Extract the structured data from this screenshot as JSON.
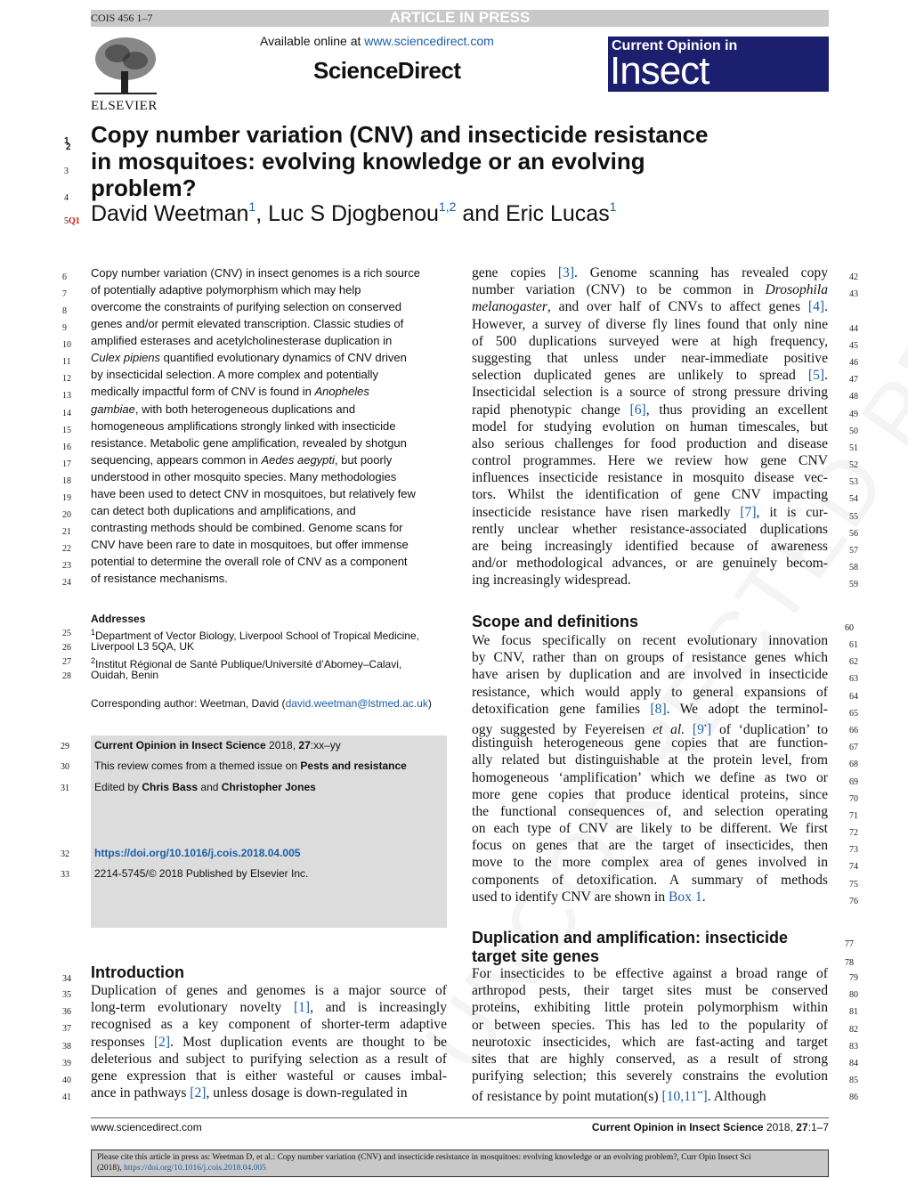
{
  "header": {
    "code": "COIS 456 1–7",
    "banner": "ARTICLE IN PRESS",
    "available_prefix": "Available online at ",
    "available_link": "www.sciencedirect.com",
    "sciencedirect": "ScienceDirect",
    "publisher": "ELSEVIER",
    "journal_line1": "Current Opinion in",
    "journal_line2": "Insect Science",
    "journal_color": "#1c1f6e"
  },
  "watermark": "UNCORRECTED PROOF",
  "title": {
    "lines": [
      {
        "n": "1",
        "n2": "2",
        "t": "Copy number variation (CNV) and insecticide resistance"
      },
      {
        "n": "3",
        "t": "in mosquitoes: evolving knowledge or an evolving"
      },
      {
        "n": "4",
        "t": "problem?"
      }
    ]
  },
  "authors": {
    "n": "5",
    "q": "Q1",
    "a1": "David Weetman",
    "s1": "1",
    "sep1": ", ",
    "a2": "Luc S Djogbenou",
    "s2": "1,2",
    "sep2": " and ",
    "a3": "Eric Lucas",
    "s3": "1"
  },
  "abstract": [
    {
      "n": "6",
      "p": [
        "Copy number variation (CNV) in insect genomes is a rich source"
      ]
    },
    {
      "n": "7",
      "p": [
        "of potentially adaptive polymorphism which may help"
      ]
    },
    {
      "n": "8",
      "p": [
        "overcome the constraints of purifying selection on conserved"
      ]
    },
    {
      "n": "9",
      "p": [
        "genes and/or permit elevated transcription. Classic studies of"
      ]
    },
    {
      "n": "10",
      "p": [
        "amplified esterases and acetylcholinesterase duplication in"
      ]
    },
    {
      "n": "11",
      "p": [
        [
          "Culex pipiens",
          "i"
        ],
        " quantified evolutionary dynamics of CNV driven"
      ]
    },
    {
      "n": "12",
      "p": [
        "by insecticidal selection. A more complex and potentially"
      ]
    },
    {
      "n": "13",
      "p": [
        "medically impactful form of CNV is found in ",
        [
          "Anopheles",
          "i"
        ]
      ]
    },
    {
      "n": "14",
      "p": [
        [
          "gambiae",
          "i"
        ],
        ", with both heterogeneous duplications and"
      ]
    },
    {
      "n": "15",
      "p": [
        "homogeneous amplifications strongly linked with insecticide"
      ]
    },
    {
      "n": "16",
      "p": [
        "resistance. Metabolic gene amplification, revealed by shotgun"
      ]
    },
    {
      "n": "17",
      "p": [
        "sequencing, appears common in ",
        [
          "Aedes aegypti",
          "i"
        ],
        ", but poorly"
      ]
    },
    {
      "n": "18",
      "p": [
        "understood in other mosquito species. Many methodologies"
      ]
    },
    {
      "n": "19",
      "p": [
        "have been used to detect CNV in mosquitoes, but relatively few"
      ]
    },
    {
      "n": "20",
      "p": [
        "can detect both duplications and amplifications, and"
      ]
    },
    {
      "n": "21",
      "p": [
        "contrasting methods should be combined. Genome scans for"
      ]
    },
    {
      "n": "22",
      "p": [
        "CNV have been rare to date in mosquitoes, but offer immense"
      ]
    },
    {
      "n": "23",
      "p": [
        "potential to determine the overall role of CNV as a component"
      ]
    },
    {
      "n": "24",
      "p": [
        "of resistance mechanisms."
      ]
    }
  ],
  "addresses": {
    "heading": "Addresses",
    "lines": [
      {
        "n": "25",
        "p": [
          [
            "1",
            "sup"
          ],
          "Department of Vector Biology, Liverpool School of Tropical Medicine,"
        ]
      },
      {
        "n": "26",
        "p": [
          "Liverpool L3 5QA, UK"
        ]
      },
      {
        "n": "27",
        "p": [
          [
            "2",
            "sup"
          ],
          "Institut Régional de Santé Publique/Université d’Abomey–Calavi,"
        ]
      },
      {
        "n": "28",
        "p": [
          "Ouidah, Benin"
        ]
      }
    ],
    "corresponding": [
      "Corresponding author: Weetman, David (",
      [
        "david.weetman@lstmed.ac.uk",
        "l"
      ],
      ")"
    ]
  },
  "infobox": [
    {
      "n": "29",
      "p": [
        [
          "Current Opinion in Insect Science",
          "b"
        ],
        " 2018, ",
        [
          "27",
          "b"
        ],
        ":xx–yy"
      ]
    },
    {
      "n": "30",
      "p": [
        "This review comes from a themed issue on ",
        [
          "Pests and resistance",
          "b"
        ]
      ]
    },
    {
      "n": "31",
      "p": [
        "Edited by ",
        [
          "Chris Bass",
          "b"
        ],
        " and ",
        [
          "Christopher Jones",
          "b"
        ]
      ]
    },
    {
      "n": "32",
      "p": [
        [
          "https://doi.org/10.1016/j.cois.2018.04.005",
          "lb"
        ]
      ]
    },
    {
      "n": "33",
      "p": [
        "2214-5745/© 2018 Published by Elsevier Inc."
      ]
    }
  ],
  "introduction": {
    "n": "34",
    "heading": "Introduction",
    "lines": [
      {
        "n": "35",
        "p": [
          "Duplication of genes and genomes is a major source of"
        ]
      },
      {
        "n": "36",
        "p": [
          "long-term evolutionary novelty ",
          [
            "[1]",
            "l"
          ],
          ", and is increasingly"
        ]
      },
      {
        "n": "37",
        "p": [
          "recognised as a key component of shorter-term adaptive"
        ]
      },
      {
        "n": "38",
        "p": [
          "responses ",
          [
            "[2]",
            "l"
          ],
          ". Most duplication events are thought to be"
        ]
      },
      {
        "n": "39",
        "p": [
          "deleterious and subject to purifying selection as a result of"
        ]
      },
      {
        "n": "40",
        "p": [
          "gene expression that is either wasteful or causes imbal-"
        ]
      },
      {
        "n": "41",
        "p": [
          "ance in pathways ",
          [
            "[2]",
            "l"
          ],
          ", unless dosage is down-regulated in"
        ]
      }
    ]
  },
  "right_intro": [
    {
      "n": "42",
      "p": [
        "gene copies ",
        [
          "[3]",
          "l"
        ],
        ". Genome scanning has revealed copy"
      ]
    },
    {
      "n": "43",
      "p": [
        "number variation (CNV) to be common in ",
        [
          "Drosophila",
          "i"
        ]
      ]
    },
    {
      "n": "",
      "p": [
        [
          "melanogaster",
          "i"
        ],
        ", and over half of CNVs to affect genes ",
        [
          "[4]",
          "l"
        ],
        "."
      ]
    },
    {
      "n": "44",
      "p": [
        "However, a survey of diverse fly lines found that only nine"
      ]
    },
    {
      "n": "45",
      "p": [
        "of 500 duplications surveyed were at high frequency,"
      ]
    },
    {
      "n": "46",
      "p": [
        "suggesting that unless under near-immediate positive"
      ]
    },
    {
      "n": "47",
      "p": [
        "selection duplicated genes are unlikely to spread ",
        [
          "[5]",
          "l"
        ],
        "."
      ]
    },
    {
      "n": "48",
      "p": [
        "Insecticidal selection is a source of strong pressure driving"
      ]
    },
    {
      "n": "49",
      "p": [
        "rapid phenotypic change ",
        [
          "[6]",
          "l"
        ],
        ", thus providing an excellent"
      ]
    },
    {
      "n": "50",
      "p": [
        "model for studying evolution on human timescales, but"
      ]
    },
    {
      "n": "51",
      "p": [
        "also serious challenges for food production and disease"
      ]
    },
    {
      "n": "52",
      "p": [
        "control programmes. Here we review how gene CNV"
      ]
    },
    {
      "n": "53",
      "p": [
        "influences insecticide resistance in mosquito disease vec-"
      ]
    },
    {
      "n": "54",
      "p": [
        "tors. Whilst the identification of gene CNV impacting"
      ]
    },
    {
      "n": "55",
      "p": [
        "insecticide resistance have risen markedly ",
        [
          "[7]",
          "l"
        ],
        ", it is cur-"
      ]
    },
    {
      "n": "56",
      "p": [
        "rently unclear whether resistance-associated duplications"
      ]
    },
    {
      "n": "57",
      "p": [
        "are being increasingly identified because of awareness"
      ]
    },
    {
      "n": "58",
      "p": [
        "and/or methodological advances, or are genuinely becom-"
      ]
    },
    {
      "n": "59",
      "p": [
        "ing increasingly widespread."
      ]
    }
  ],
  "scope": {
    "n": "60",
    "heading": "Scope and definitions",
    "lines": [
      {
        "n": "61",
        "p": [
          "We focus specifically on recent evolutionary innovation"
        ]
      },
      {
        "n": "62",
        "p": [
          "by CNV, rather than on groups of resistance genes which"
        ]
      },
      {
        "n": "63",
        "p": [
          "have arisen by duplication and are involved in insecticide"
        ]
      },
      {
        "n": "64",
        "p": [
          "resistance, which would apply to general expansions of"
        ]
      },
      {
        "n": "65",
        "p": [
          "detoxification gene families ",
          [
            "[8]",
            "l"
          ],
          ". We adopt the terminol-"
        ]
      },
      {
        "n": "66",
        "p": [
          "ogy suggested by Feyereisen ",
          [
            "et al.",
            "i"
          ],
          " ",
          [
            "[9",
            "l"
          ],
          [
            "•",
            "lsup"
          ],
          [
            "]",
            "l"
          ],
          " of ‘duplication’ to"
        ]
      },
      {
        "n": "67",
        "p": [
          "distinguish heterogeneous gene copies that are function-"
        ]
      },
      {
        "n": "68",
        "p": [
          "ally related but distinguishable at the protein level, from"
        ]
      },
      {
        "n": "69",
        "p": [
          "homogeneous ‘amplification’ which we define as two or"
        ]
      },
      {
        "n": "70",
        "p": [
          "more gene copies that produce identical proteins, since"
        ]
      },
      {
        "n": "71",
        "p": [
          "the functional consequences of, and selection operating"
        ]
      },
      {
        "n": "72",
        "p": [
          "on each type of CNV are likely to be different. We first"
        ]
      },
      {
        "n": "73",
        "p": [
          "focus on genes that are the target of insecticides, then"
        ]
      },
      {
        "n": "74",
        "p": [
          "move to the more complex area of genes involved in"
        ]
      },
      {
        "n": "75",
        "p": [
          "components of detoxification. A summary of methods"
        ]
      },
      {
        "n": "76",
        "p": [
          "used to identify CNV are shown in ",
          [
            "Box 1",
            "l"
          ],
          "."
        ]
      }
    ]
  },
  "duplication": {
    "heading": [
      {
        "n": "77",
        "t": "Duplication and amplification: insecticide"
      },
      {
        "n": "78",
        "t": "target site genes"
      }
    ],
    "lines": [
      {
        "n": "79",
        "p": [
          "For insecticides to be effective against a broad range of"
        ]
      },
      {
        "n": "80",
        "p": [
          "arthropod pests, their target sites must be conserved"
        ]
      },
      {
        "n": "81",
        "p": [
          "proteins, exhibiting little protein polymorphism within"
        ]
      },
      {
        "n": "82",
        "p": [
          "or between species. This has led to the popularity of"
        ]
      },
      {
        "n": "83",
        "p": [
          "neurotoxic insecticides, which are fast-acting and target"
        ]
      },
      {
        "n": "84",
        "p": [
          "sites that are highly conserved, as a result of strong"
        ]
      },
      {
        "n": "85",
        "p": [
          "purifying selection; this severely constrains the evolution"
        ]
      },
      {
        "n": "86",
        "p": [
          "of resistance by point mutation(s) ",
          [
            "[10,11",
            "l"
          ],
          [
            "••",
            "lsup"
          ],
          [
            "]",
            "l"
          ],
          ". Although"
        ]
      }
    ]
  },
  "footer": {
    "left": "www.sciencedirect.com",
    "journal": "Current Opinion in Insect Science",
    "year": " 2018, ",
    "vol": "27",
    "pages": ":1–7"
  },
  "cite_box": {
    "text": "Please cite this article in press as: Weetman D, et al.: Copy number variation (CNV) and insecticide resistance in mosquitoes: evolving knowledge or an evolving problem?, Curr Opin Insect Sci",
    "text2": "(2018), ",
    "link": "https://doi.org/10.1016/j.cois.2018.04.005"
  }
}
